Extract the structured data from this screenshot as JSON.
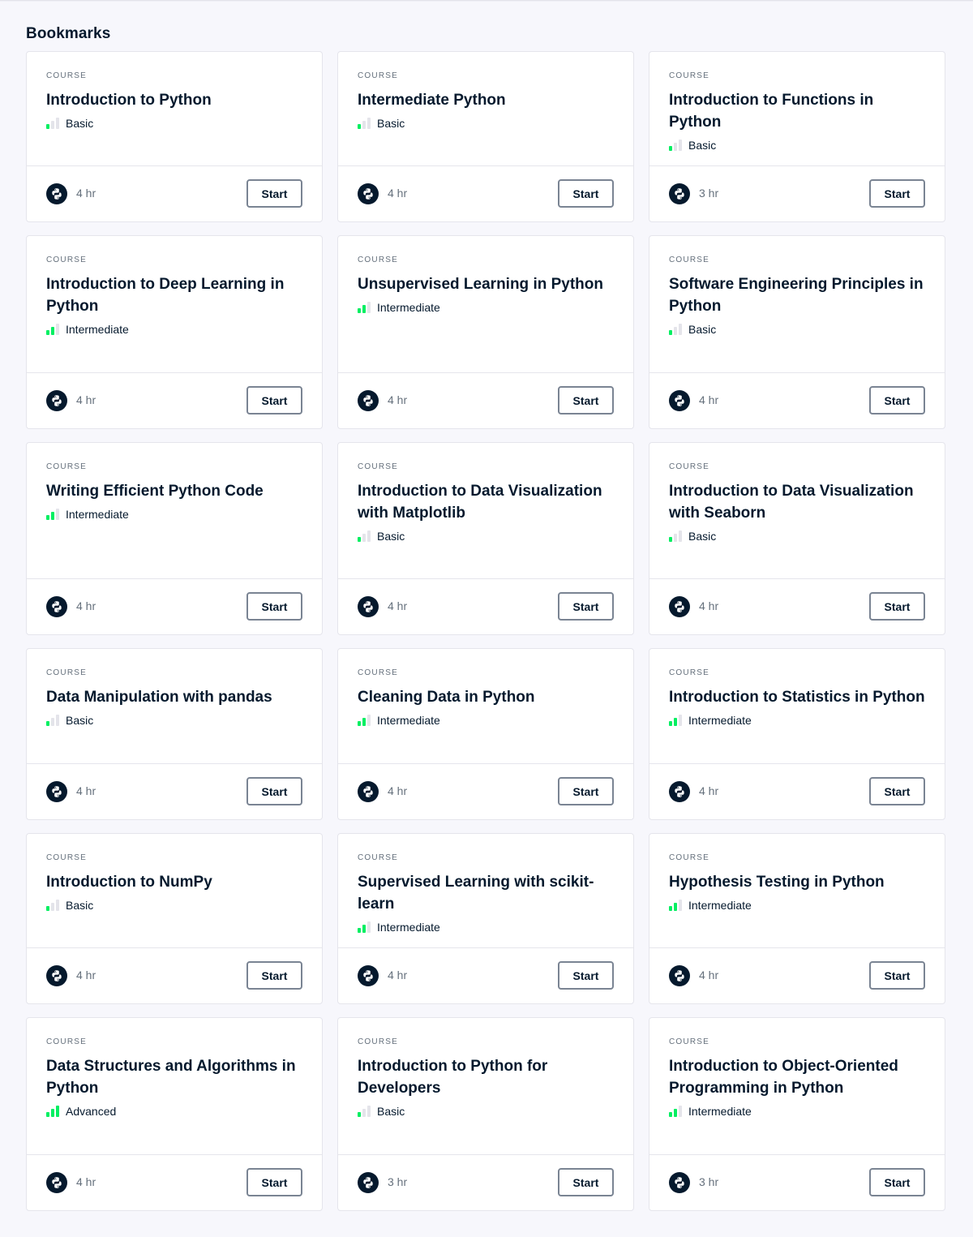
{
  "section": {
    "title": "Bookmarks"
  },
  "colors": {
    "accent": "#03ef62",
    "text": "#05192d",
    "muted": "#65707c",
    "background": "#f7f7fc"
  },
  "courses": [
    {
      "type": "COURSE",
      "title": "Introduction to Python",
      "level": "Basic",
      "level_bars": 1,
      "duration": "4 hr",
      "icon": "python-icon",
      "action": "Start"
    },
    {
      "type": "COURSE",
      "title": "Intermediate Python",
      "level": "Basic",
      "level_bars": 1,
      "duration": "4 hr",
      "icon": "python-icon",
      "action": "Start"
    },
    {
      "type": "COURSE",
      "title": "Introduction to Functions in Python",
      "level": "Basic",
      "level_bars": 1,
      "duration": "3 hr",
      "icon": "python-icon",
      "action": "Start"
    },
    {
      "type": "COURSE",
      "title": "Introduction to Deep Learning in Python",
      "level": "Intermediate",
      "level_bars": 2,
      "duration": "4 hr",
      "icon": "python-icon",
      "action": "Start"
    },
    {
      "type": "COURSE",
      "title": "Unsupervised Learning in Python",
      "level": "Intermediate",
      "level_bars": 2,
      "duration": "4 hr",
      "icon": "python-icon",
      "action": "Start"
    },
    {
      "type": "COURSE",
      "title": "Software Engineering Principles in Python",
      "level": "Basic",
      "level_bars": 1,
      "duration": "4 hr",
      "icon": "python-icon",
      "action": "Start"
    },
    {
      "type": "COURSE",
      "title": "Writing Efficient Python Code",
      "level": "Intermediate",
      "level_bars": 2,
      "duration": "4 hr",
      "icon": "python-icon",
      "action": "Start"
    },
    {
      "type": "COURSE",
      "title": "Introduction to Data Visualization with Matplotlib",
      "level": "Basic",
      "level_bars": 1,
      "duration": "4 hr",
      "icon": "python-icon",
      "action": "Start"
    },
    {
      "type": "COURSE",
      "title": "Introduction to Data Visualization with Seaborn",
      "level": "Basic",
      "level_bars": 1,
      "duration": "4 hr",
      "icon": "python-icon",
      "action": "Start"
    },
    {
      "type": "COURSE",
      "title": "Data Manipulation with pandas",
      "level": "Basic",
      "level_bars": 1,
      "duration": "4 hr",
      "icon": "python-icon",
      "action": "Start"
    },
    {
      "type": "COURSE",
      "title": "Cleaning Data in Python",
      "level": "Intermediate",
      "level_bars": 2,
      "duration": "4 hr",
      "icon": "python-icon",
      "action": "Start"
    },
    {
      "type": "COURSE",
      "title": "Introduction to Statistics in Python",
      "level": "Intermediate",
      "level_bars": 2,
      "duration": "4 hr",
      "icon": "python-icon",
      "action": "Start"
    },
    {
      "type": "COURSE",
      "title": "Introduction to NumPy",
      "level": "Basic",
      "level_bars": 1,
      "duration": "4 hr",
      "icon": "python-icon",
      "action": "Start"
    },
    {
      "type": "COURSE",
      "title": "Supervised Learning with scikit-learn",
      "level": "Intermediate",
      "level_bars": 2,
      "duration": "4 hr",
      "icon": "python-icon",
      "action": "Start"
    },
    {
      "type": "COURSE",
      "title": "Hypothesis Testing in Python",
      "level": "Intermediate",
      "level_bars": 2,
      "duration": "4 hr",
      "icon": "python-icon",
      "action": "Start"
    },
    {
      "type": "COURSE",
      "title": "Data Structures and Algorithms in Python",
      "level": "Advanced",
      "level_bars": 3,
      "duration": "4 hr",
      "icon": "python-icon",
      "action": "Start"
    },
    {
      "type": "COURSE",
      "title": "Introduction to Python for Developers",
      "level": "Basic",
      "level_bars": 1,
      "duration": "3 hr",
      "icon": "python-icon",
      "action": "Start"
    },
    {
      "type": "COURSE",
      "title": "Introduction to Object-Oriented Programming in Python",
      "level": "Intermediate",
      "level_bars": 2,
      "duration": "3 hr",
      "icon": "python-icon",
      "action": "Start"
    }
  ]
}
